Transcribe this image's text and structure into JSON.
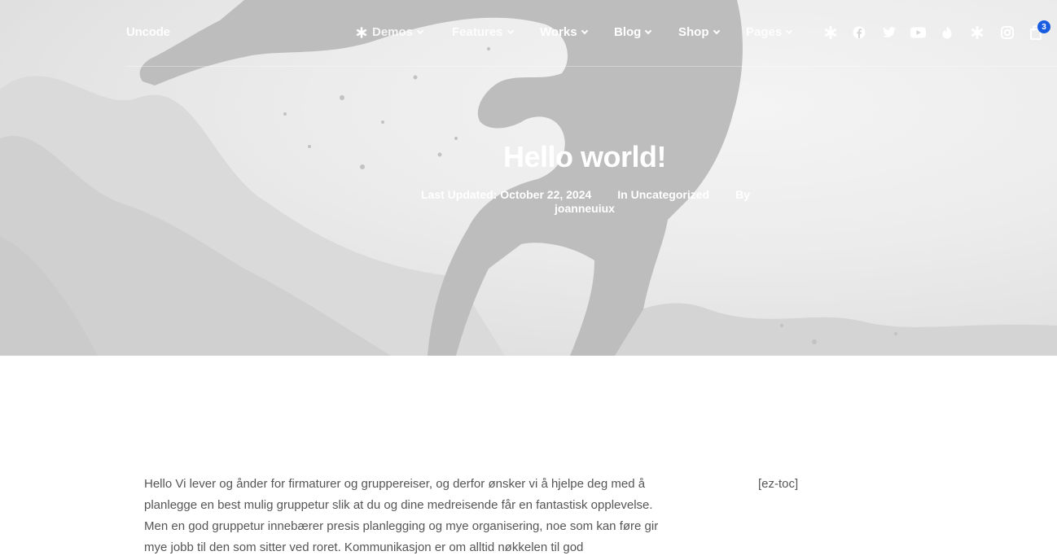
{
  "header": {
    "logo": "Uncode",
    "nav": [
      {
        "label": "Demos",
        "has_icon": true
      },
      {
        "label": "Features"
      },
      {
        "label": "Works"
      },
      {
        "label": "Blog"
      },
      {
        "label": "Shop"
      },
      {
        "label": "Pages"
      }
    ],
    "social_icons": [
      "asterisk-icon",
      "facebook-icon",
      "twitter-icon",
      "youtube-icon",
      "dribbble-icon",
      "asterisk-icon",
      "instagram-icon"
    ],
    "cart": {
      "icon": "shopping-bag-icon",
      "count": "3"
    }
  },
  "hero": {
    "title": "Hello world!",
    "last_updated": "Last Updated: October 22, 2024",
    "category": "In Uncategorized",
    "by": "By",
    "author": "joanneuiux"
  },
  "content": {
    "lines": [
      "Hello Vi lever og ånder for firmaturer og gruppereiser, og derfor ønsker vi å hjelpe deg med å",
      "planlegge en best mulig gruppetur slik at du og dine medreisende får en fantastisk opplevelse.",
      "Men en god gruppetur innebærer presis planlegging og mye organisering, noe som kan føre gir",
      "mye jobb til den som sitter ved roret. Kommunikasjon er om alltid nøkkelen til god"
    ],
    "sidebar": "[ez-toc]"
  },
  "colors": {
    "badge": "#1a5de0",
    "text": "#555555",
    "hero_text": "#ffffff"
  }
}
